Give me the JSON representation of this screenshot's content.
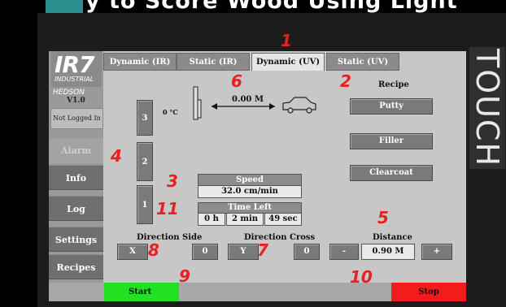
{
  "top_caption": "y to Score Wood Using Light",
  "touch_label": "TOUCH",
  "brand": {
    "logo": "IR7",
    "logo_sub": "INDUSTRIAL",
    "partner": "HEDSON",
    "version": "V1.0",
    "login_status": "Not Logged In"
  },
  "sidebar": {
    "items": [
      {
        "label": "Alarm",
        "enabled": false
      },
      {
        "label": "Info"
      },
      {
        "label": "Log"
      },
      {
        "label": "Settings"
      },
      {
        "label": "Recipes"
      }
    ]
  },
  "tabs": [
    {
      "label": "Dynamic (IR)"
    },
    {
      "label": "Static (IR)"
    },
    {
      "label": "Dynamic (UV)",
      "active": true
    },
    {
      "label": "Static (UV)"
    }
  ],
  "lamps": [
    {
      "label": "3"
    },
    {
      "label": "2"
    },
    {
      "label": "1"
    }
  ],
  "temperature": "0 °C",
  "distance_reading": "0.00 M",
  "recipe": {
    "heading": "Recipe",
    "items": [
      "Putty",
      "Filler",
      "Clearcoat"
    ]
  },
  "speed": {
    "heading": "Speed",
    "value": "32.0 cm/min"
  },
  "time_left": {
    "heading": "Time Left",
    "h": "0 h",
    "min": "2 min",
    "sec": "49 sec"
  },
  "direction_side": {
    "heading": "Direction Side",
    "axis": "X",
    "value": "0"
  },
  "direction_cross": {
    "heading": "Direction Cross",
    "axis": "Y",
    "value": "0"
  },
  "distance": {
    "heading": "Distance",
    "minus": "-",
    "value": "0.90 M",
    "plus": "+"
  },
  "controls": {
    "start": "Start",
    "stop": "Stop"
  },
  "annotations": [
    "1",
    "2",
    "3",
    "4",
    "5",
    "6",
    "7",
    "8",
    "9",
    "10",
    "11"
  ],
  "colors": {
    "start": "#22e022",
    "stop": "#f21c1c",
    "annotation": "#e82020"
  }
}
